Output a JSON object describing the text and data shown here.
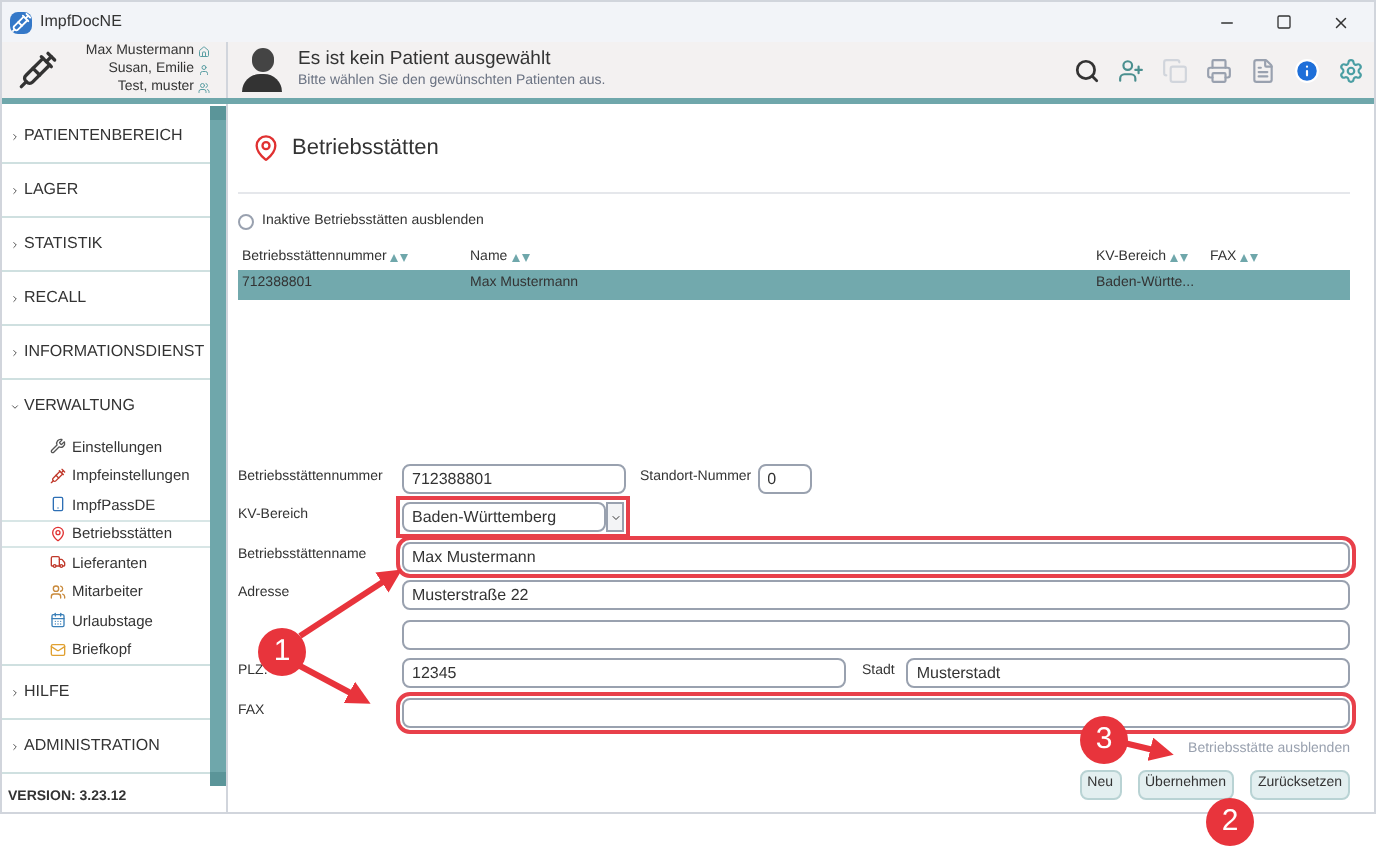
{
  "window": {
    "title": "ImpfDocNE"
  },
  "header": {
    "users": [
      {
        "name": "Max Mustermann",
        "kind": "practice"
      },
      {
        "name": "Susan, Emilie",
        "kind": "doctor"
      },
      {
        "name": "Test, muster",
        "kind": "staff"
      }
    ],
    "patient_title": "Es ist kein Patient ausgewählt",
    "patient_hint": "Bitte wählen Sie den gewünschten Patienten aus."
  },
  "sidebar": {
    "sections": [
      {
        "label": "PATIENTENBEREICH",
        "expanded": false
      },
      {
        "label": "LAGER",
        "expanded": false
      },
      {
        "label": "STATISTIK",
        "expanded": false
      },
      {
        "label": "RECALL",
        "expanded": false
      },
      {
        "label": "INFORMATIONSDIENST",
        "expanded": false
      },
      {
        "label": "VERWALTUNG",
        "expanded": true,
        "children": [
          {
            "label": "Einstellungen",
            "kind": "tools",
            "selected": false
          },
          {
            "label": "Impfeinstellungen",
            "kind": "syringe",
            "selected": false
          },
          {
            "label": "ImpfPassDE",
            "kind": "phone",
            "selected": false
          },
          {
            "label": "Betriebsstätten",
            "kind": "pin",
            "selected": true
          },
          {
            "label": "Lieferanten",
            "kind": "truck",
            "selected": false
          },
          {
            "label": "Mitarbeiter",
            "kind": "people",
            "selected": false
          },
          {
            "label": "Urlaubstage",
            "kind": "calendar",
            "selected": false
          },
          {
            "label": "Briefkopf",
            "kind": "mail",
            "selected": false
          }
        ]
      },
      {
        "label": "HILFE",
        "expanded": false
      },
      {
        "label": "ADMINISTRATION",
        "expanded": false
      }
    ],
    "version": "VERSION: 3.23.12"
  },
  "page": {
    "title": "Betriebsstätten",
    "hide_inactive": {
      "label": "Inaktive Betriebsstätten ausblenden",
      "checked": false
    }
  },
  "table": {
    "columns": [
      "Betriebsstättennummer",
      "Name",
      "KV-Bereich",
      "FAX"
    ],
    "rows": [
      {
        "cells": [
          "712388801",
          "Max Mustermann",
          "Baden-Württe...",
          ""
        ],
        "selected": true
      }
    ]
  },
  "form": {
    "rows": [
      {
        "fields": [
          {
            "label": "Betriebsstättennummer",
            "value": "712388801",
            "kind": "text",
            "highlighted": false
          },
          {
            "label": "Standort-Nummer",
            "value": "0",
            "kind": "text",
            "highlighted": false
          }
        ]
      },
      {
        "fields": [
          {
            "label": "KV-Bereich",
            "value": "Baden-Württemberg",
            "kind": "select",
            "highlighted": true
          }
        ]
      },
      {
        "fields": [
          {
            "label": "Betriebsstättenname",
            "value": "Max Mustermann",
            "kind": "text",
            "highlighted": true
          }
        ]
      },
      {
        "fields": [
          {
            "label": "Adresse",
            "value": "Musterstraße 22",
            "kind": "text",
            "highlighted": false
          }
        ]
      },
      {
        "fields": [
          {
            "kind": "text",
            "highlighted": false
          }
        ]
      },
      {
        "fields": [
          {
            "label": "PLZ:",
            "value": "12345",
            "kind": "text",
            "highlighted": false
          },
          {
            "label": "Stadt",
            "value": "Musterstadt",
            "kind": "text",
            "highlighted": false
          }
        ]
      },
      {
        "fields": [
          {
            "label": "FAX",
            "kind": "text",
            "highlighted": true
          }
        ]
      }
    ],
    "hide_link": "Betriebsstätte ausblenden",
    "buttons": [
      {
        "label": "Neu"
      },
      {
        "label": "Übernehmen"
      },
      {
        "label": "Zurücksetzen"
      }
    ]
  },
  "annotations": [
    {
      "label": "1"
    },
    {
      "label": "2"
    },
    {
      "label": "3"
    }
  ]
}
